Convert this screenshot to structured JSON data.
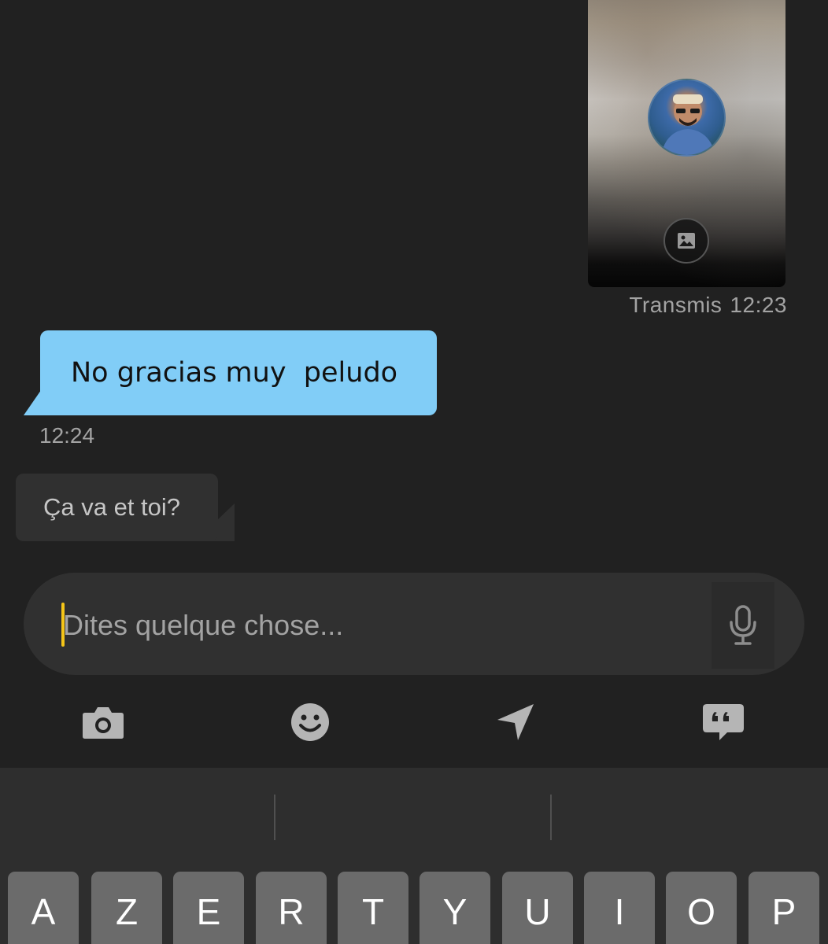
{
  "photo_message": {
    "status": "Transmis",
    "time": "12:23",
    "avatar_icon": "profile-photo",
    "badge_icon": "image-icon"
  },
  "messages": [
    {
      "direction": "outgoing",
      "text": "No gracias muy  peludo",
      "time": "12:24",
      "color": "#81cdf7"
    },
    {
      "direction": "incoming",
      "text": "Ça va et toi?",
      "color": "#303030"
    }
  ],
  "composer": {
    "placeholder": "Dites quelque chose...",
    "value": "",
    "caret_color": "#f5c518",
    "mic_icon": "microphone-icon"
  },
  "toolbar": [
    {
      "icon": "camera-icon"
    },
    {
      "icon": "emoji-icon"
    },
    {
      "icon": "location-icon"
    },
    {
      "icon": "quick-reply-icon"
    }
  ],
  "keyboard": {
    "row1": [
      "A",
      "Z",
      "E",
      "R",
      "T",
      "Y",
      "U",
      "I",
      "O",
      "P"
    ]
  }
}
